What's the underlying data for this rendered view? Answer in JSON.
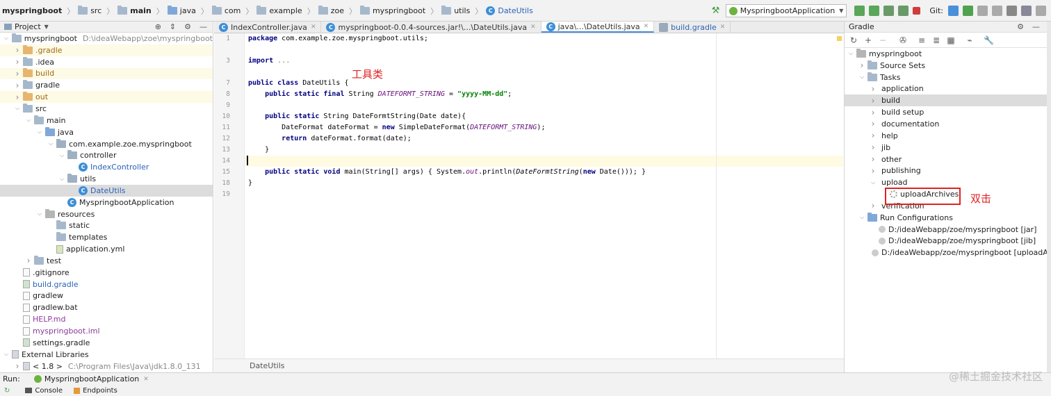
{
  "breadcrumb": [
    "myspringboot",
    "src",
    "main",
    "java",
    "com",
    "example",
    "zoe",
    "myspringboot",
    "utils",
    "DateUtils"
  ],
  "toolbar": {
    "run_config": "MyspringbootApplication",
    "git_label": "Git:"
  },
  "project_panel": {
    "title": "Project"
  },
  "project_tree": [
    {
      "label": "myspringboot",
      "extra": "D:\\ideaWebapp\\zoe\\myspringboot",
      "depth": 0,
      "exp": "v",
      "icon": "project-folder-icon"
    },
    {
      "label": ".gradle",
      "depth": 1,
      "exp": ">",
      "icon": "orange-folder-icon",
      "hl": true
    },
    {
      "label": ".idea",
      "depth": 1,
      "exp": ">",
      "icon": "folder-icon"
    },
    {
      "label": "build",
      "depth": 1,
      "exp": ">",
      "icon": "orange-folder-icon",
      "hl": true
    },
    {
      "label": "gradle",
      "depth": 1,
      "exp": ">",
      "icon": "folder-icon"
    },
    {
      "label": "out",
      "depth": 1,
      "exp": ">",
      "icon": "orange-folder-icon",
      "hl": true
    },
    {
      "label": "src",
      "depth": 1,
      "exp": "v",
      "icon": "folder-icon"
    },
    {
      "label": "main",
      "depth": 2,
      "exp": "v",
      "icon": "folder-icon"
    },
    {
      "label": "java",
      "depth": 3,
      "exp": "v",
      "icon": "blue-folder-icon"
    },
    {
      "label": "com.example.zoe.myspringboot",
      "depth": 4,
      "exp": "v",
      "icon": "package-icon"
    },
    {
      "label": "controller",
      "depth": 5,
      "exp": "v",
      "icon": "package-icon"
    },
    {
      "label": "IndexController",
      "depth": 6,
      "exp": "",
      "icon": "java-class-icon",
      "blue": true
    },
    {
      "label": "utils",
      "depth": 5,
      "exp": "v",
      "icon": "package-icon"
    },
    {
      "label": "DateUtils",
      "depth": 6,
      "exp": "",
      "icon": "java-class-icon",
      "blue": true,
      "sel": true
    },
    {
      "label": "MyspringbootApplication",
      "depth": 5,
      "exp": "",
      "icon": "spring-app-icon"
    },
    {
      "label": "resources",
      "depth": 3,
      "exp": "v",
      "icon": "resources-folder-icon"
    },
    {
      "label": "static",
      "depth": 4,
      "exp": "",
      "icon": "folder-icon"
    },
    {
      "label": "templates",
      "depth": 4,
      "exp": "",
      "icon": "folder-icon"
    },
    {
      "label": "application.yml",
      "depth": 4,
      "exp": "",
      "icon": "yml-file-icon"
    },
    {
      "label": "test",
      "depth": 2,
      "exp": ">",
      "icon": "folder-icon"
    },
    {
      "label": ".gitignore",
      "depth": 1,
      "exp": "",
      "icon": "file-icon"
    },
    {
      "label": "build.gradle",
      "depth": 1,
      "exp": "",
      "icon": "gradle-file-icon",
      "blue": true
    },
    {
      "label": "gradlew",
      "depth": 1,
      "exp": "",
      "icon": "file-icon"
    },
    {
      "label": "gradlew.bat",
      "depth": 1,
      "exp": "",
      "icon": "file-icon"
    },
    {
      "label": "HELP.md",
      "depth": 1,
      "exp": "",
      "icon": "md-file-icon",
      "purple": true
    },
    {
      "label": "myspringboot.iml",
      "depth": 1,
      "exp": "",
      "icon": "iml-file-icon",
      "purple": true
    },
    {
      "label": "settings.gradle",
      "depth": 1,
      "exp": "",
      "icon": "gradle-file-icon"
    },
    {
      "label": "External Libraries",
      "depth": 0,
      "exp": "v",
      "icon": "library-icon"
    },
    {
      "label": "< 1.8 >",
      "extra": "C:\\Program Files\\Java\\jdk1.8.0_131",
      "depth": 1,
      "exp": ">",
      "icon": "jdk-icon"
    }
  ],
  "editor_tabs": [
    {
      "label": "IndexController.java",
      "active": false
    },
    {
      "label": "myspringboot-0.0.4-sources.jar!\\...\\DateUtils.java",
      "active": false
    },
    {
      "label": "java\\...\\DateUtils.java",
      "active": true
    },
    {
      "label": "build.gradle",
      "active": false
    }
  ],
  "line_numbers": [
    "1",
    "",
    "3",
    "",
    "7",
    "8",
    "9",
    "10",
    "11",
    "12",
    "13",
    "14",
    "15",
    "18",
    "19"
  ],
  "code_lines": [
    "<span class='kw'>package</span> com.example.zoe.myspringboot.utils;",
    "",
    "<span class='kw'>import</span> <span style='color:#777'>...</span>",
    "",
    "<span class='kw'>public class</span> DateUtils {",
    "    <span class='kw'>public static final</span> String <span class='fi'>DATEFORMT_STRING</span> = <span class='st'>\"yyyy-MM-dd\"</span>;",
    "",
    "    <span class='kw'>public static</span> String DateFormtString(Date date){",
    "        DateFormat dateFormat = <span class='kw'>new</span> SimpleDateFormat(<span class='fi'>DATEFORMT_STRING</span>);",
    "        <span class='kw'>return</span> dateFormat.format(date);",
    "    }",
    "",
    "    <span class='kw'>public static void</span> main(String[] args) { System.<span class='fi'>out</span>.println(<span class='ca'>DateFormtString</span>(<span class='kw'>new</span> Date())); }",
    "}",
    ""
  ],
  "annotation_tool_class": "工具类",
  "annotation_double_click": "双击",
  "editor_footer": "DateUtils",
  "gradle_panel": {
    "title": "Gradle"
  },
  "gradle_tree": [
    {
      "label": "myspringboot",
      "depth": 0,
      "exp": "v",
      "icon": "gradle-project-icon"
    },
    {
      "label": "Source Sets",
      "depth": 1,
      "exp": ">",
      "icon": "source-sets-icon"
    },
    {
      "label": "Tasks",
      "depth": 1,
      "exp": "v",
      "icon": "tasks-folder-icon"
    },
    {
      "label": "application",
      "depth": 2,
      "exp": ">",
      "icon": "task-group-icon"
    },
    {
      "label": "build",
      "depth": 2,
      "exp": ">",
      "icon": "task-group-icon",
      "sel": true
    },
    {
      "label": "build setup",
      "depth": 2,
      "exp": ">",
      "icon": "task-group-icon"
    },
    {
      "label": "documentation",
      "depth": 2,
      "exp": ">",
      "icon": "task-group-icon"
    },
    {
      "label": "help",
      "depth": 2,
      "exp": ">",
      "icon": "task-group-icon"
    },
    {
      "label": "jib",
      "depth": 2,
      "exp": ">",
      "icon": "task-group-icon"
    },
    {
      "label": "other",
      "depth": 2,
      "exp": ">",
      "icon": "task-group-icon"
    },
    {
      "label": "publishing",
      "depth": 2,
      "exp": ">",
      "icon": "task-group-icon"
    },
    {
      "label": "upload",
      "depth": 2,
      "exp": "v",
      "icon": "task-group-icon"
    },
    {
      "label": "uploadArchives",
      "depth": 3,
      "exp": "",
      "icon": "gear-icon"
    },
    {
      "label": "verification",
      "depth": 2,
      "exp": ">",
      "icon": "task-group-icon"
    },
    {
      "label": "Run Configurations",
      "depth": 1,
      "exp": "v",
      "icon": "run-configs-icon"
    },
    {
      "label": "D:/ideaWebapp/zoe/myspringboot [jar]",
      "depth": 2,
      "exp": "",
      "icon": "run-config-icon"
    },
    {
      "label": "D:/ideaWebapp/zoe/myspringboot [jib]",
      "depth": 2,
      "exp": "",
      "icon": "run-config-icon"
    },
    {
      "label": "D:/ideaWebapp/zoe/myspringboot [uploadArchi",
      "depth": 2,
      "exp": "",
      "icon": "run-config-icon"
    }
  ],
  "run_bar": {
    "label": "Run:",
    "config": "MyspringbootApplication"
  },
  "bottom_tabs": [
    {
      "label": "Console"
    },
    {
      "label": "Endpoints"
    }
  ],
  "watermark": "@稀土掘金技术社区"
}
